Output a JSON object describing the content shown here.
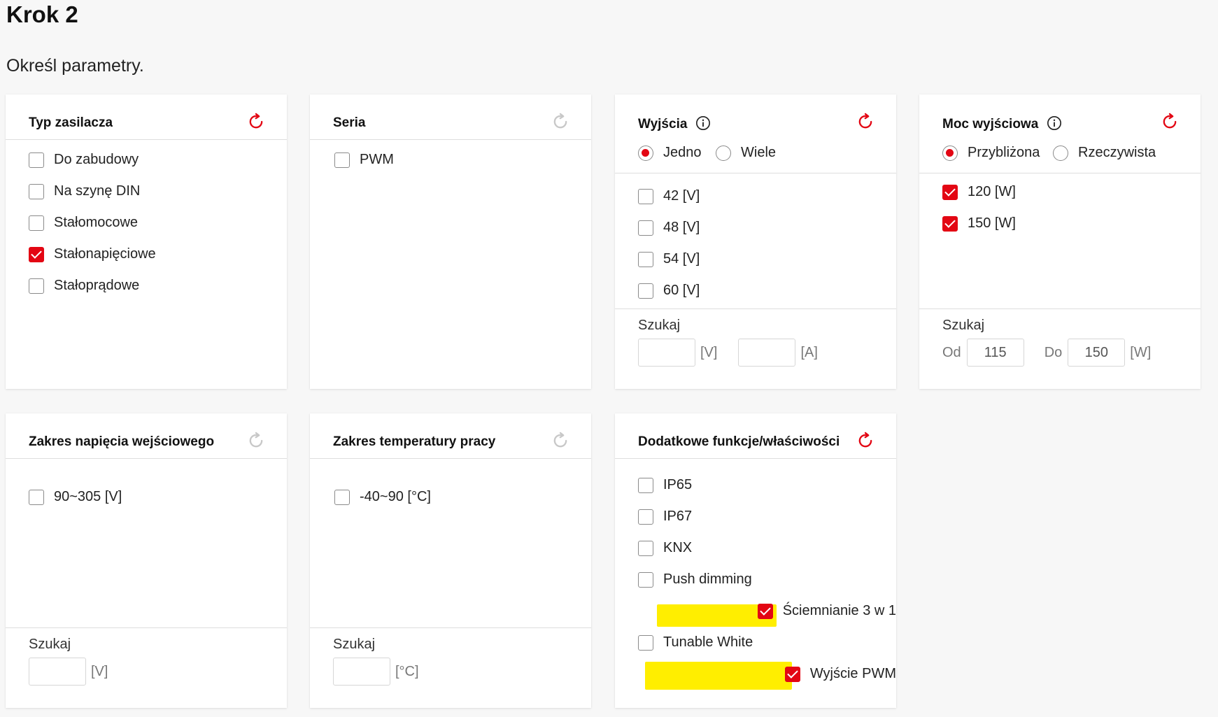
{
  "page": {
    "title": "Krok 2",
    "subtitle": "Określ parametry."
  },
  "colors": {
    "accent": "#e30613",
    "highlight": "#ffee00",
    "reset_inactive": "#c8c8c8"
  },
  "cards": {
    "typ": {
      "title": "Typ zasilacza",
      "options": [
        {
          "label": "Do zabudowy",
          "checked": false
        },
        {
          "label": "Na szynę DIN",
          "checked": false
        },
        {
          "label": "Stałomocowe",
          "checked": false
        },
        {
          "label": "Stałonapięciowe",
          "checked": true
        },
        {
          "label": "Stałoprądowe",
          "checked": false
        }
      ]
    },
    "seria": {
      "title": "Seria",
      "options": [
        {
          "label": "PWM",
          "checked": false
        }
      ]
    },
    "wyjscia": {
      "title": "Wyjścia",
      "radios": [
        {
          "label": "Jedno",
          "selected": true
        },
        {
          "label": "Wiele",
          "selected": false
        }
      ],
      "options": [
        {
          "label": "42 [V]",
          "checked": false
        },
        {
          "label": "48 [V]",
          "checked": false
        },
        {
          "label": "54 [V]",
          "checked": false
        },
        {
          "label": "60 [V]",
          "checked": false
        }
      ],
      "search": {
        "label": "Szukaj",
        "v_value": "",
        "v_unit": "[V]",
        "a_value": "",
        "a_unit": "[A]"
      }
    },
    "moc": {
      "title": "Moc wyjściowa",
      "radios": [
        {
          "label": "Przybliżona",
          "selected": true
        },
        {
          "label": "Rzeczywista",
          "selected": false
        }
      ],
      "options": [
        {
          "label": "120 [W]",
          "checked": true
        },
        {
          "label": "150 [W]",
          "checked": true
        }
      ],
      "search": {
        "label": "Szukaj",
        "from_label": "Od",
        "from_value": "115",
        "to_label": "Do",
        "to_value": "150",
        "unit": "[W]"
      }
    },
    "napiecie": {
      "title": "Zakres napięcia wejściowego",
      "options": [
        {
          "label": "90~305 [V]",
          "checked": false
        }
      ],
      "search": {
        "label": "Szukaj",
        "value": "",
        "unit": "[V]"
      }
    },
    "temperatura": {
      "title": "Zakres temperatury pracy",
      "options": [
        {
          "label": "-40~90 [°C]",
          "checked": false
        }
      ],
      "search": {
        "label": "Szukaj",
        "value": "",
        "unit": "[°C]"
      }
    },
    "dodatkowe": {
      "title": "Dodatkowe funkcje/właściwości",
      "options": [
        {
          "label": "IP65",
          "checked": false,
          "highlighted": false
        },
        {
          "label": "IP67",
          "checked": false,
          "highlighted": false
        },
        {
          "label": "KNX",
          "checked": false,
          "highlighted": false
        },
        {
          "label": "Push dimming",
          "checked": false,
          "highlighted": false
        },
        {
          "label": "Ściemnianie 3 w 1",
          "checked": true,
          "highlighted": true
        },
        {
          "label": "Tunable White",
          "checked": false,
          "highlighted": false
        },
        {
          "label": "Wyjście PWM",
          "checked": true,
          "highlighted": true
        }
      ]
    }
  }
}
